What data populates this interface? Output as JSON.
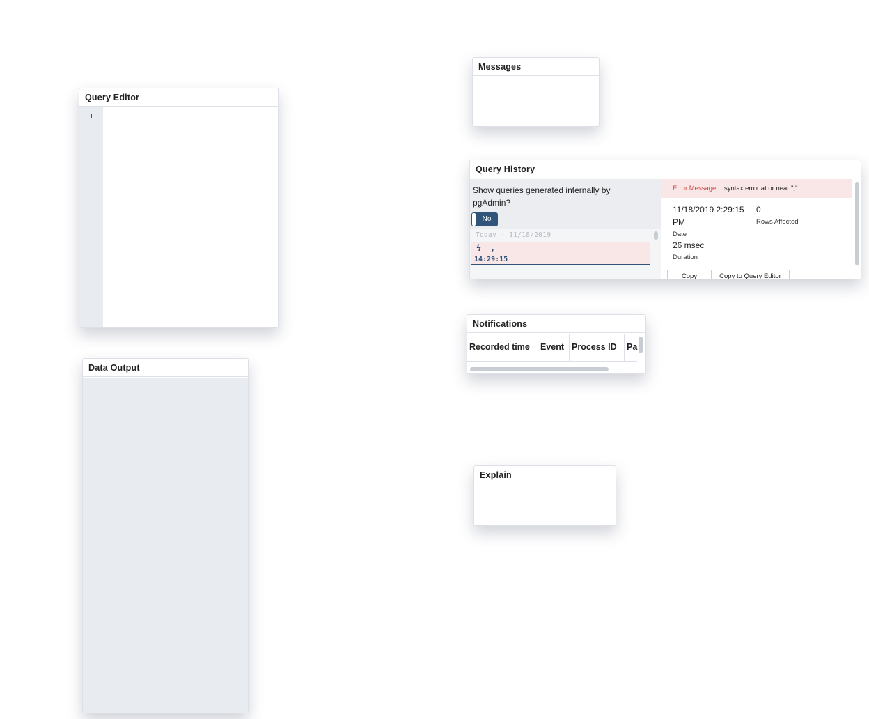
{
  "query_editor": {
    "title": "Query Editor",
    "line_numbers": [
      "1"
    ]
  },
  "data_output": {
    "title": "Data Output"
  },
  "messages": {
    "title": "Messages"
  },
  "query_history": {
    "title": "Query History",
    "toggle_question": "Show queries generated internally by pgAdmin?",
    "toggle_value": "No",
    "group_date": "Today - 11/18/2019",
    "entry": {
      "icon": "lightning-icon",
      "query": ",",
      "time": "14:29:15",
      "status": "error"
    },
    "detail": {
      "error_label": "Error Message",
      "error_text": "syntax error at or near \",\"",
      "date_value": "11/18/2019 2:29:15 PM",
      "date_label": "Date",
      "rows_value": "0",
      "rows_label": "Rows Affected",
      "duration_value": "26 msec",
      "duration_label": "Duration",
      "copy_label": "Copy",
      "copy_to_editor_label": "Copy to Query Editor"
    }
  },
  "notifications": {
    "title": "Notifications",
    "columns": [
      "Recorded time",
      "Event",
      "Process ID",
      "Pa"
    ]
  },
  "explain": {
    "title": "Explain"
  },
  "colors": {
    "accent": "#30547a",
    "error_bg": "#f9e6e6",
    "error_text": "#d0423a",
    "gutter": "#e8ebf0"
  }
}
